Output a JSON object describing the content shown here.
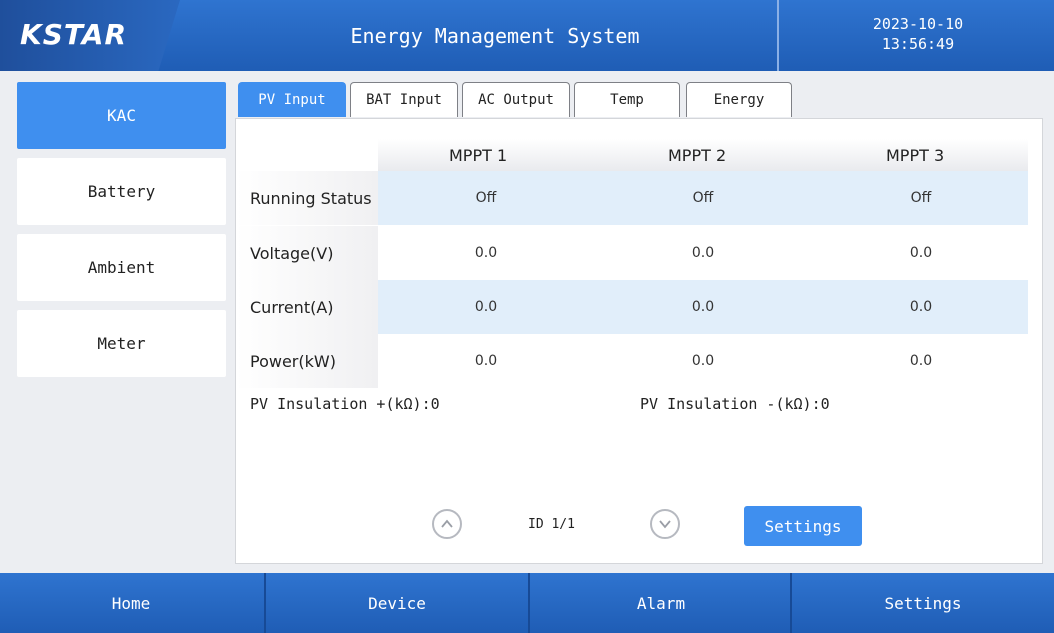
{
  "header": {
    "logo": "KSTAR",
    "title": "Energy Management System",
    "date": "2023-10-10",
    "time": "13:56:49"
  },
  "sidebar": {
    "items": [
      {
        "label": "KAC",
        "active": true
      },
      {
        "label": "Battery",
        "active": false
      },
      {
        "label": "Ambient",
        "active": false
      },
      {
        "label": "Meter",
        "active": false
      }
    ]
  },
  "tabs": [
    {
      "label": "PV Input",
      "active": true
    },
    {
      "label": "BAT Input",
      "active": false
    },
    {
      "label": "AC Output",
      "active": false
    },
    {
      "label": "Temp",
      "active": false
    },
    {
      "label": "Energy",
      "active": false
    }
  ],
  "table": {
    "columns": [
      "MPPT 1",
      "MPPT 2",
      "MPPT 3"
    ],
    "rows": [
      {
        "label": "Running Status",
        "values": [
          "Off",
          "Off",
          "Off"
        ]
      },
      {
        "label": "Voltage(V)",
        "values": [
          "0.0",
          "0.0",
          "0.0"
        ]
      },
      {
        "label": "Current(A)",
        "values": [
          "0.0",
          "0.0",
          "0.0"
        ]
      },
      {
        "label": "Power(kW)",
        "values": [
          "0.0",
          "0.0",
          "0.0"
        ]
      }
    ]
  },
  "insulation": {
    "positive": "PV Insulation +(kΩ):0",
    "negative": "PV Insulation -(kΩ):0"
  },
  "pager": {
    "id_label": "ID 1/1",
    "settings_label": "Settings"
  },
  "bottom_nav": [
    "Home",
    "Device",
    "Alarm",
    "Settings"
  ],
  "colors": {
    "accent": "#3f8fef",
    "header": "#2667c2",
    "row_highlight": "#e1eefa"
  }
}
